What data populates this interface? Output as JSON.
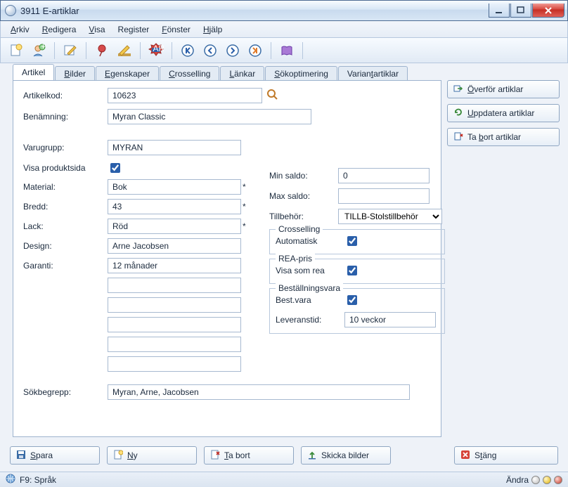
{
  "window": {
    "title": "3911 E-artiklar"
  },
  "menu": {
    "arkiv": "Arkiv",
    "redigera": "Redigera",
    "visa": "Visa",
    "register": "Register",
    "fonster": "Fönster",
    "hjalp": "Hjälp"
  },
  "tabs": {
    "artikel": "Artikel",
    "bilder": "Bilder",
    "egenskaper": "Egenskaper",
    "crosselling": "Crosselling",
    "lankar": "Länkar",
    "sokoptimering": "Sökoptimering",
    "variantartiklar": "Variantartiklar"
  },
  "labels": {
    "artikelkod": "Artikelkod:",
    "benamning": "Benämning:",
    "varugrupp": "Varugrupp:",
    "visa_produktsida": "Visa produktsida",
    "material": "Material:",
    "bredd": "Bredd:",
    "lack": "Lack:",
    "design": "Design:",
    "garanti": "Garanti:",
    "sokbegrepp": "Sökbegrepp:",
    "min_saldo": "Min saldo:",
    "max_saldo": "Max saldo:",
    "tillbehor": "Tillbehör:",
    "crosselling_grp": "Crosselling",
    "automatisk": "Automatisk",
    "rea_grp": "REA-pris",
    "visa_som_rea": "Visa som rea",
    "bestallning_grp": "Beställningsvara",
    "best_vara": "Best.vara",
    "leveranstid": "Leveranstid:"
  },
  "values": {
    "artikelkod": "10623",
    "benamning": "Myran Classic",
    "varugrupp": "MYRAN",
    "material": "Bok",
    "bredd": "43",
    "lack": "Röd",
    "design": "Arne Jacobsen",
    "garanti": "12 månader",
    "sokbegrepp": "Myran, Arne, Jacobsen",
    "min_saldo": "0",
    "max_saldo": "",
    "tillbehor_selected": "TILLB-Stolstillbehör",
    "leveranstid": "10 veckor",
    "visa_produktsida": true,
    "automatisk": true,
    "visa_som_rea": true,
    "best_vara": true
  },
  "side_buttons": {
    "overfor": "Överför artiklar",
    "uppdatera": "Uppdatera artiklar",
    "tabort": "Ta bort artiklar"
  },
  "bottom_buttons": {
    "spara": "Spara",
    "ny": "Ny",
    "tabort": "Ta bort",
    "skicka": "Skicka bilder",
    "stang": "Stäng"
  },
  "status": {
    "left": "F9: Språk",
    "right": "Ändra"
  }
}
